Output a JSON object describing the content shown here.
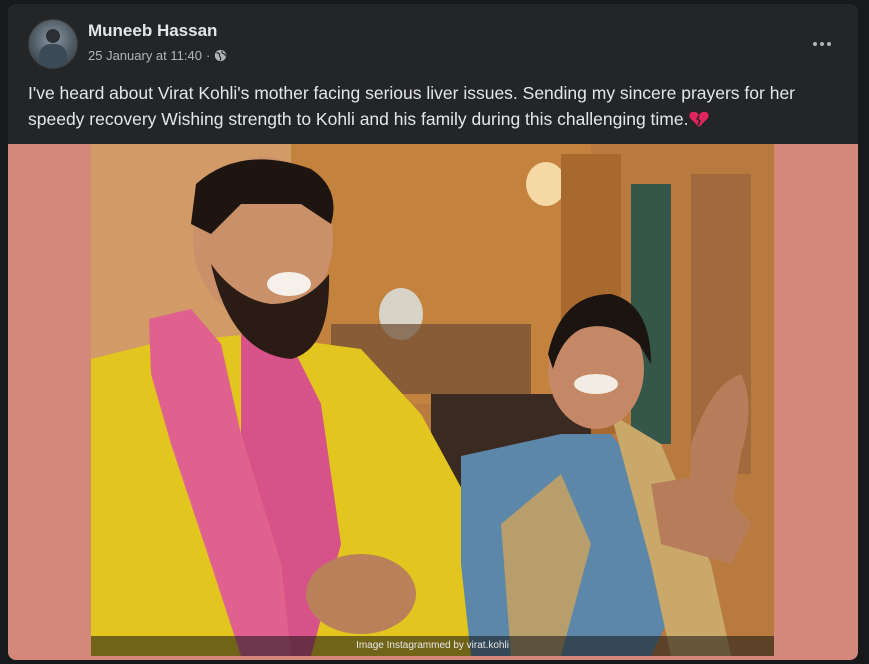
{
  "post": {
    "author": "Muneeb Hassan",
    "timestamp": "25 January at 11:40",
    "separator": "·",
    "privacy_icon": "globe-icon",
    "more_icon": "more-options-icon",
    "text": "I've heard about Virat Kohli's mother facing serious liver issues. Sending my sincere prayers for her speedy  recovery  Wishing strength to Kohli and his family during this challenging time.",
    "emoji_icon": "broken-heart-icon",
    "image_caption": "Image Instagrammed by virat.kohli"
  },
  "colors": {
    "background": "#18191a",
    "card": "#242526",
    "primary_text": "#e4e6eb",
    "secondary_text": "#b0b3b8",
    "media_backdrop": "#d4887a",
    "heart": "#e0245e"
  }
}
